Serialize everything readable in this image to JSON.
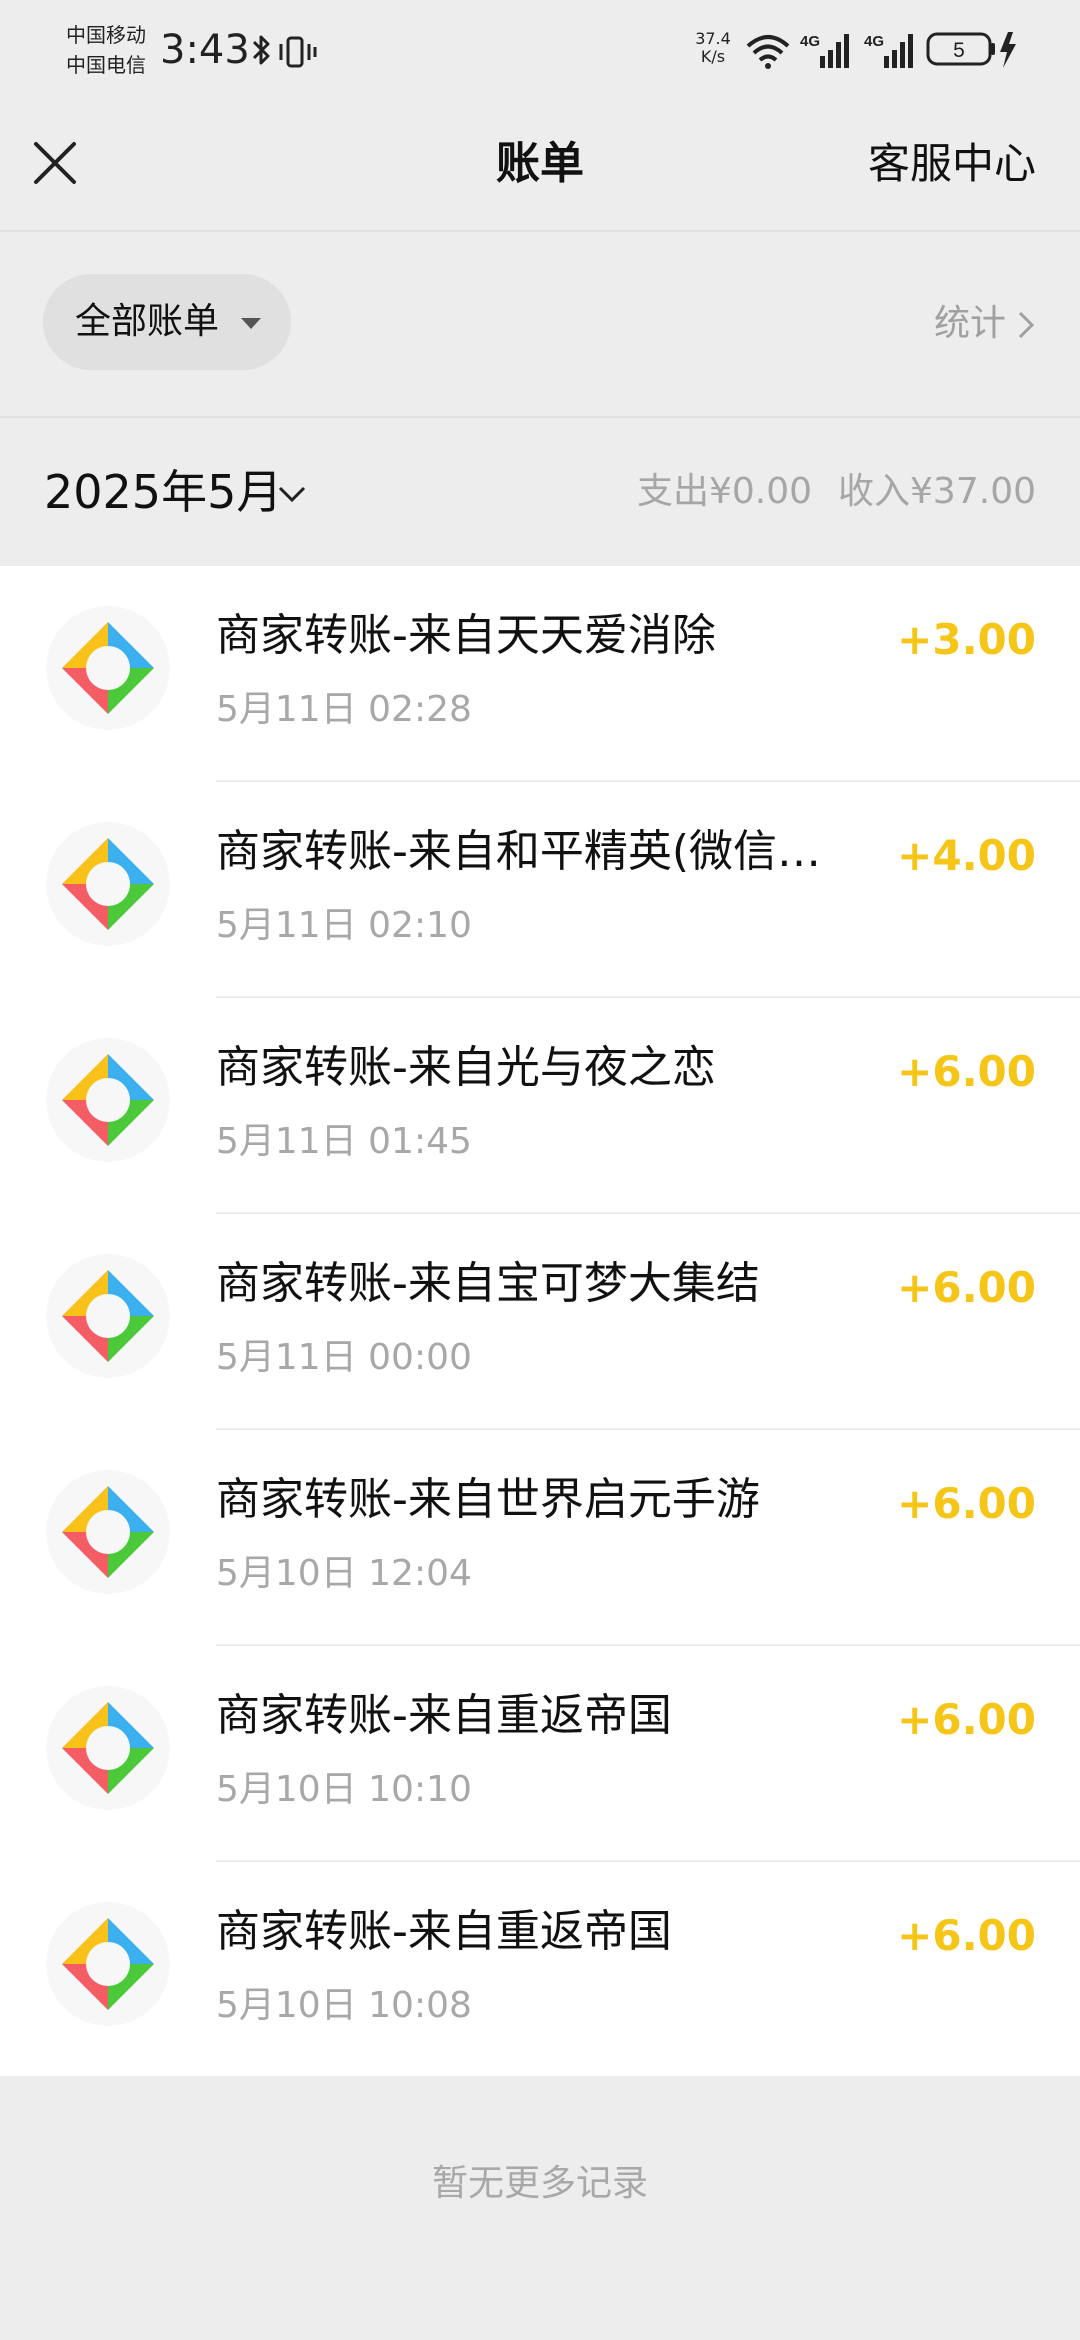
{
  "status_bar": {
    "carrier_1": "中国移动",
    "carrier_2": "中国电信",
    "time": "3:43",
    "net_speed_value": "37.4",
    "net_speed_unit": "K/s",
    "signal_1_label": "4G",
    "signal_2_label": "4G",
    "battery_level": "5",
    "icons": [
      "bluetooth-icon",
      "vibrate-icon",
      "wifi-icon",
      "signal-icon",
      "battery-icon",
      "charging-icon"
    ]
  },
  "header": {
    "title": "账单",
    "close_icon": "close-icon",
    "service_label": "客服中心"
  },
  "filter": {
    "selected": "全部账单",
    "stats_label": "统计"
  },
  "month": {
    "label": "2025年5月",
    "expense_label": "支出",
    "expense_value": "¥0.00",
    "income_label": "收入",
    "income_value": "¥37.00"
  },
  "transactions": [
    {
      "title": "商家转账-来自天天爱消除",
      "time": "5月11日 02:28",
      "amount": "+3.00"
    },
    {
      "title": "商家转账-来自和平精英(微信…",
      "time": "5月11日 02:10",
      "amount": "+4.00"
    },
    {
      "title": "商家转账-来自光与夜之恋",
      "time": "5月11日 01:45",
      "amount": "+6.00"
    },
    {
      "title": "商家转账-来自宝可梦大集结",
      "time": "5月11日 00:00",
      "amount": "+6.00"
    },
    {
      "title": "商家转账-来自世界启元手游",
      "time": "5月10日 12:04",
      "amount": "+6.00"
    },
    {
      "title": "商家转账-来自重返帝国",
      "time": "5月10日 10:10",
      "amount": "+6.00"
    },
    {
      "title": "商家转账-来自重返帝国",
      "time": "5月10日 10:08",
      "amount": "+6.00"
    }
  ],
  "footer": {
    "no_more": "暂无更多记录"
  },
  "colors": {
    "background": "#ededed",
    "list_background": "#ffffff",
    "amount_income": "#f5c518",
    "muted_text": "#a8a8a8",
    "logo_blue": "#3cb0ee",
    "logo_yellow": "#f9c21b",
    "logo_red": "#f45d64",
    "logo_green": "#4cc93a"
  }
}
